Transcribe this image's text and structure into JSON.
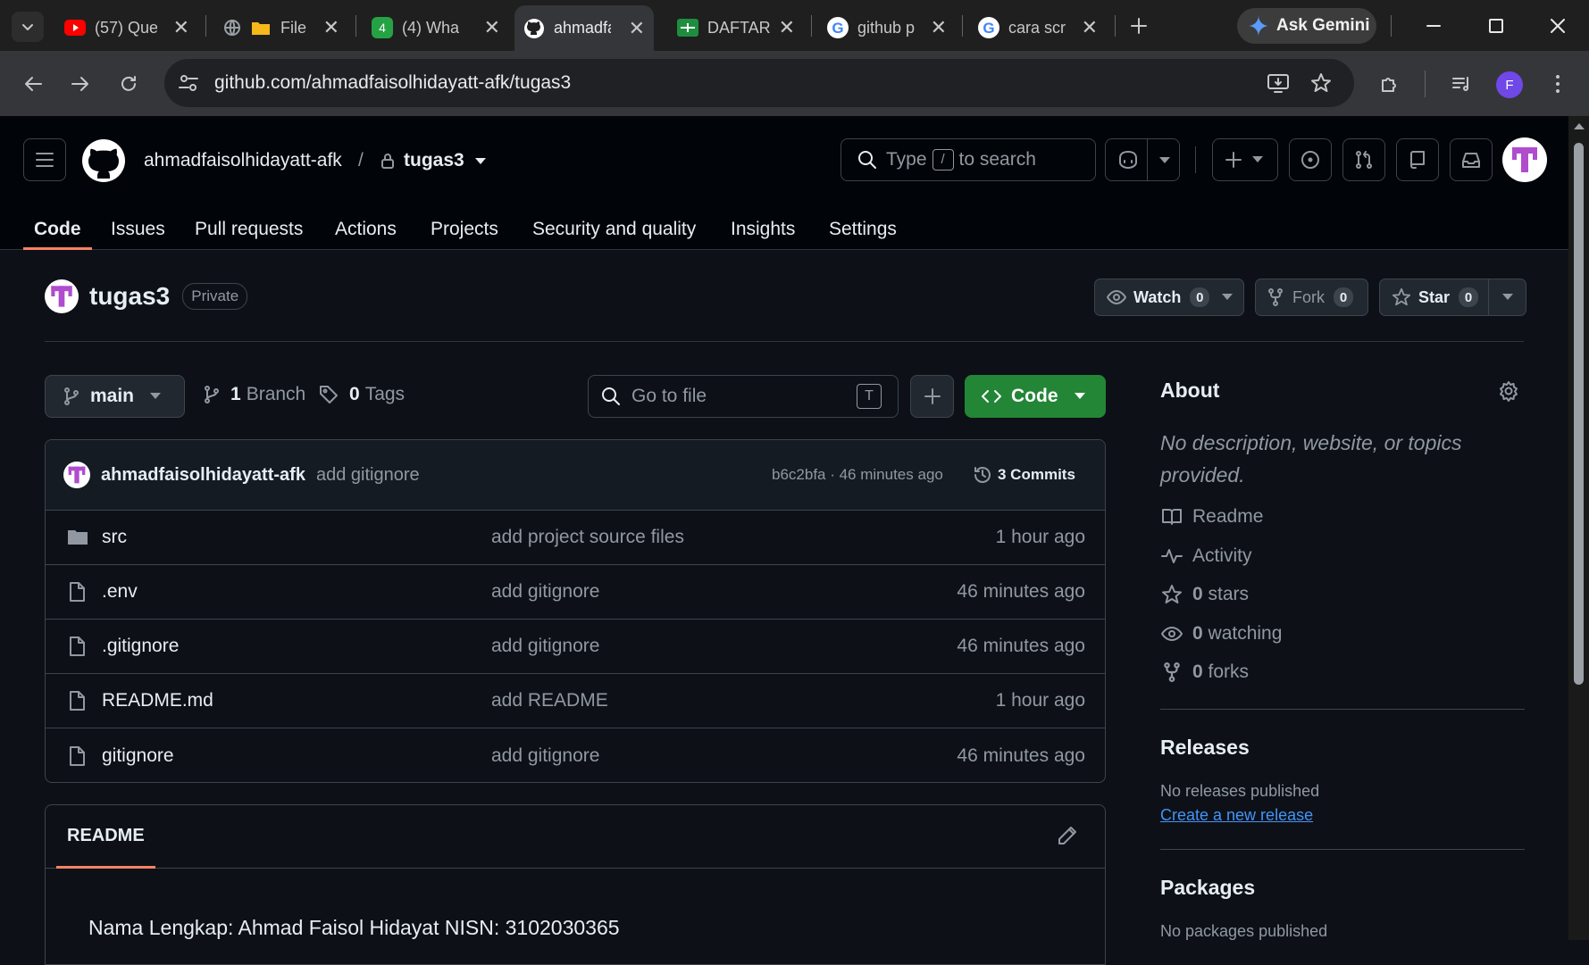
{
  "browser": {
    "tabs": [
      {
        "title": "(57) Que",
        "icon": "youtube-icon"
      },
      {
        "title": "File",
        "icon": "folder-icon"
      },
      {
        "title": "(4) Wha",
        "icon": "whatsapp-icon",
        "badge": "4"
      },
      {
        "title": "ahmadfa",
        "icon": "github-icon",
        "active": true
      },
      {
        "title": "DAFTAR",
        "icon": "sheets-icon"
      },
      {
        "title": "github p",
        "icon": "google-icon"
      },
      {
        "title": "cara scr",
        "icon": "google-icon"
      }
    ],
    "gemini_label": "Ask Gemini",
    "url": "github.com/ahmadfaisolhidayatt-afk/tugas3",
    "profile_initial": "F"
  },
  "github": {
    "owner": "ahmadfaisolhidayatt-afk",
    "separator": "/",
    "repo": "tugas3",
    "search": {
      "prefix": "Type",
      "key": "/",
      "suffix": "to search"
    },
    "nav": [
      "Code",
      "Issues",
      "Pull requests",
      "Actions",
      "Projects",
      "Security and quality",
      "Insights",
      "Settings"
    ],
    "visibility": "Private",
    "watch": {
      "label": "Watch",
      "count": "0"
    },
    "fork": {
      "label": "Fork",
      "count": "0"
    },
    "star": {
      "label": "Star",
      "count": "0"
    }
  },
  "files": {
    "branch": "main",
    "branches": {
      "count": "1",
      "label": "Branch"
    },
    "tags": {
      "count": "0",
      "label": "Tags"
    },
    "go_to_file": "Go to file",
    "go_to_file_key": "T",
    "code_button": "Code",
    "latest_commit": {
      "author": "ahmadfaisolhidayatt-afk",
      "message": "add gitignore",
      "hash_time": "b6c2bfa · 46 minutes ago",
      "commits_label": "3 Commits"
    },
    "rows": [
      {
        "name": "src",
        "type": "folder",
        "message": "add project source files",
        "time": "1 hour ago"
      },
      {
        "name": ".env",
        "type": "file",
        "message": "add gitignore",
        "time": "46 minutes ago"
      },
      {
        "name": ".gitignore",
        "type": "file",
        "message": "add gitignore",
        "time": "46 minutes ago"
      },
      {
        "name": "README.md",
        "type": "file",
        "message": "add README",
        "time": "1 hour ago"
      },
      {
        "name": "gitignore",
        "type": "file",
        "message": "add gitignore",
        "time": "46 minutes ago"
      }
    ]
  },
  "readme": {
    "tab": "README",
    "content": "Nama Lengkap: Ahmad Faisol Hidayat NISN: 3102030365"
  },
  "about": {
    "title": "About",
    "description": "No description, website, or topics provided.",
    "items": [
      {
        "icon": "book-icon",
        "label": "Readme"
      },
      {
        "icon": "pulse-icon",
        "label": "Activity"
      },
      {
        "icon": "star-icon",
        "count": "0",
        "label": "stars"
      },
      {
        "icon": "eye-icon",
        "count": "0",
        "label": "watching"
      },
      {
        "icon": "fork-icon",
        "count": "0",
        "label": "forks"
      }
    ],
    "releases_title": "Releases",
    "releases_text": "No releases published",
    "releases_link": "Create a new release",
    "packages_title": "Packages",
    "packages_text": "No packages published"
  },
  "colors": {
    "accent_green": "#238636",
    "tab_underline": "#f78166",
    "link": "#4493f8"
  }
}
